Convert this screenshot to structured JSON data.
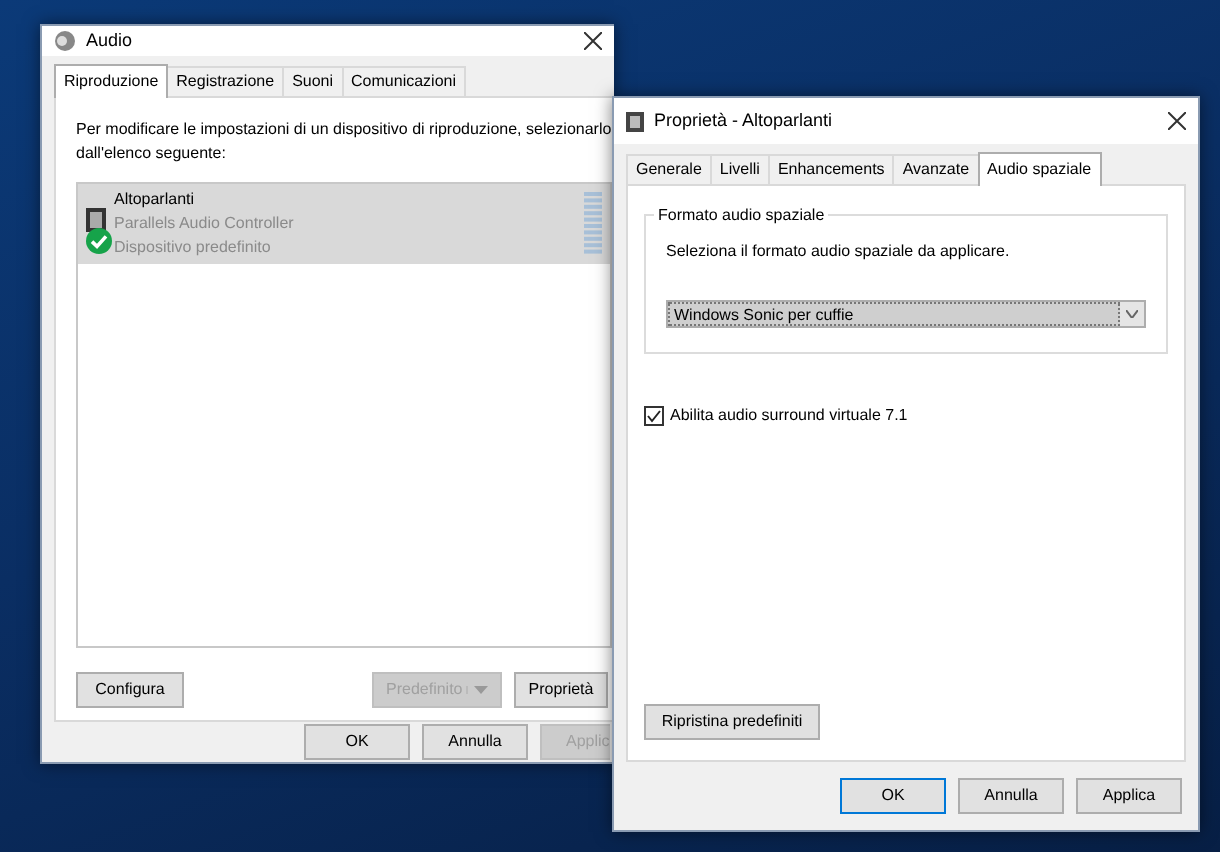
{
  "audio_window": {
    "title": "Audio",
    "tabs": [
      {
        "label": "Riproduzione",
        "selected": true
      },
      {
        "label": "Registrazione",
        "selected": false
      },
      {
        "label": "Suoni",
        "selected": false
      },
      {
        "label": "Comunicazioni",
        "selected": false
      }
    ],
    "instructions": "Per modificare le impostazioni di un dispositivo di riproduzione, selezionarlo dall'elenco seguente:",
    "devices": [
      {
        "name": "Altoparlanti",
        "driver": "Parallels Audio Controller",
        "status": "Dispositivo predefinito",
        "selected": true,
        "default": true
      }
    ],
    "buttons": [
      {
        "label": "Configura",
        "disabled": false
      },
      {
        "label": "Predefinito",
        "disabled": true,
        "kind": "split"
      },
      {
        "label": "Proprietà",
        "disabled": false
      }
    ],
    "footer_buttons": [
      {
        "label": "OK",
        "disabled": false
      },
      {
        "label": "Annulla",
        "disabled": false
      },
      {
        "label": "Applic",
        "disabled": true
      }
    ]
  },
  "properties_window": {
    "title": "Proprietà - Altoparlanti",
    "tabs": [
      {
        "label": "Generale",
        "selected": false
      },
      {
        "label": "Livelli",
        "selected": false
      },
      {
        "label": "Enhancements",
        "selected": false
      },
      {
        "label": "Avanzate",
        "selected": false
      },
      {
        "label": "Audio spaziale",
        "selected": true
      }
    ],
    "group_title": "Formato audio spaziale",
    "group_text": "Seleziona il formato audio spaziale da applicare.",
    "format_select": "Windows Sonic per cuffie",
    "surround_checkbox": {
      "label": "Abilita audio surround virtuale 7.1",
      "checked": true
    },
    "restore_button": "Ripristina predefiniti",
    "footer_buttons": [
      {
        "label": "OK",
        "disabled": false
      },
      {
        "label": "Annulla",
        "disabled": false
      },
      {
        "label": "Applica",
        "disabled": false
      }
    ]
  }
}
